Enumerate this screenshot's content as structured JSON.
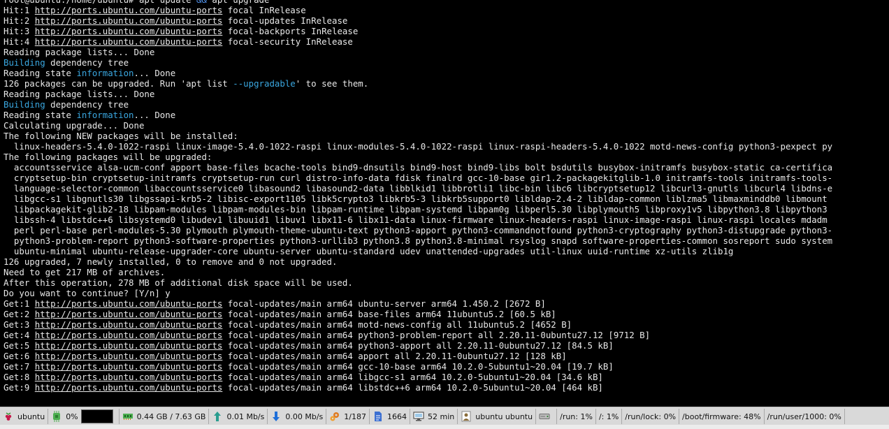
{
  "terminal": {
    "lines": [
      [
        {
          "t": "root@ubuntu:/home/ubuntu# apt update "
        },
        {
          "t": "&&",
          "c": "blue"
        },
        {
          "t": " apt upgrade"
        }
      ],
      [
        {
          "t": "Hit:1 "
        },
        {
          "t": "http://ports.ubuntu.com/ubuntu-ports",
          "c": "url"
        },
        {
          "t": " focal InRelease"
        }
      ],
      [
        {
          "t": "Hit:2 "
        },
        {
          "t": "http://ports.ubuntu.com/ubuntu-ports",
          "c": "url"
        },
        {
          "t": " focal-updates InRelease"
        }
      ],
      [
        {
          "t": "Hit:3 "
        },
        {
          "t": "http://ports.ubuntu.com/ubuntu-ports",
          "c": "url"
        },
        {
          "t": " focal-backports InRelease"
        }
      ],
      [
        {
          "t": "Hit:4 "
        },
        {
          "t": "http://ports.ubuntu.com/ubuntu-ports",
          "c": "url"
        },
        {
          "t": " focal-security InRelease"
        }
      ],
      [
        {
          "t": "Reading package lists... Done"
        }
      ],
      [
        {
          "t": "Building",
          "c": "cyan"
        },
        {
          "t": " dependency tree"
        }
      ],
      [
        {
          "t": "Reading state "
        },
        {
          "t": "information",
          "c": "cyan"
        },
        {
          "t": "... Done"
        }
      ],
      [
        {
          "t": "126 packages can be upgraded. Run 'apt list "
        },
        {
          "t": "--upgradable",
          "c": "cyan"
        },
        {
          "t": "' to see them."
        }
      ],
      [
        {
          "t": "Reading package lists... Done"
        }
      ],
      [
        {
          "t": "Building",
          "c": "cyan"
        },
        {
          "t": " dependency tree"
        }
      ],
      [
        {
          "t": "Reading state "
        },
        {
          "t": "information",
          "c": "cyan"
        },
        {
          "t": "... Done"
        }
      ],
      [
        {
          "t": "Calculating upgrade... Done"
        }
      ],
      [
        {
          "t": "The following NEW packages will be installed:"
        }
      ],
      [
        {
          "t": "  linux-headers-5.4.0-1022-raspi linux-image-5.4.0-1022-raspi linux-modules-5.4.0-1022-raspi linux-raspi-headers-5.4.0-1022 motd-news-config python3-pexpect py"
        }
      ],
      [
        {
          "t": "The following packages will be upgraded:"
        }
      ],
      [
        {
          "t": "  accountsservice alsa-ucm-conf apport base-files bcache-tools bind9-dnsutils bind9-host bind9-libs bolt bsdutils busybox-initramfs busybox-static ca-certifica"
        }
      ],
      [
        {
          "t": "  cryptsetup-bin cryptsetup-initramfs cryptsetup-run curl distro-info-data fdisk finalrd gcc-10-base gir1.2-packagekitglib-1.0 initramfs-tools initramfs-tools-"
        }
      ],
      [
        {
          "t": "  language-selector-common libaccountsservice0 libasound2 libasound2-data libblkid1 libbrotli1 libc-bin libc6 libcryptsetup12 libcurl3-gnutls libcurl4 libdns-e"
        }
      ],
      [
        {
          "t": "  libgcc-s1 libgnutls30 libgssapi-krb5-2 libisc-export1105 libk5crypto3 libkrb5-3 libkrb5support0 libldap-2.4-2 libldap-common liblzma5 libmaxminddb0 libmount"
        }
      ],
      [
        {
          "t": "  libpackagekit-glib2-18 libpam-modules libpam-modules-bin libpam-runtime libpam-systemd libpam0g libperl5.30 libplymouth5 libproxy1v5 libpython3.8 libpython3"
        }
      ],
      [
        {
          "t": "  libssh-4 libstdc++6 libsystemd0 libudev1 libuuid1 libuv1 libx11-6 libx11-data linux-firmware linux-headers-raspi linux-image-raspi linux-raspi locales mdadm"
        }
      ],
      [
        {
          "t": "  perl perl-base perl-modules-5.30 plymouth plymouth-theme-ubuntu-text python3-apport python3-commandnotfound python3-cryptography python3-distupgrade python3-"
        }
      ],
      [
        {
          "t": "  python3-problem-report python3-software-properties python3-urllib3 python3.8 python3.8-minimal rsyslog snapd software-properties-common sosreport sudo system"
        }
      ],
      [
        {
          "t": "  ubuntu-minimal ubuntu-release-upgrader-core ubuntu-server ubuntu-standard udev unattended-upgrades util-linux uuid-runtime xz-utils zlib1g"
        }
      ],
      [
        {
          "t": "126 upgraded, 7 newly installed, 0 to remove and 0 not upgraded."
        }
      ],
      [
        {
          "t": "Need to get 217 MB of archives."
        }
      ],
      [
        {
          "t": "After this operation, 278 MB of additional disk space will be used."
        }
      ],
      [
        {
          "t": "Do you want to continue? [Y/n] y"
        }
      ],
      [
        {
          "t": "Get:1 "
        },
        {
          "t": "http://ports.ubuntu.com/ubuntu-ports",
          "c": "url"
        },
        {
          "t": " focal-updates/main arm64 ubuntu-server arm64 1.450.2 [2672 B]"
        }
      ],
      [
        {
          "t": "Get:2 "
        },
        {
          "t": "http://ports.ubuntu.com/ubuntu-ports",
          "c": "url"
        },
        {
          "t": " focal-updates/main arm64 base-files arm64 11ubuntu5.2 [60.5 kB]"
        }
      ],
      [
        {
          "t": "Get:3 "
        },
        {
          "t": "http://ports.ubuntu.com/ubuntu-ports",
          "c": "url"
        },
        {
          "t": " focal-updates/main arm64 motd-news-config all 11ubuntu5.2 [4652 B]"
        }
      ],
      [
        {
          "t": "Get:4 "
        },
        {
          "t": "http://ports.ubuntu.com/ubuntu-ports",
          "c": "url"
        },
        {
          "t": " focal-updates/main arm64 python3-problem-report all 2.20.11-0ubuntu27.12 [9712 B]"
        }
      ],
      [
        {
          "t": "Get:5 "
        },
        {
          "t": "http://ports.ubuntu.com/ubuntu-ports",
          "c": "url"
        },
        {
          "t": " focal-updates/main arm64 python3-apport all 2.20.11-0ubuntu27.12 [84.5 kB]"
        }
      ],
      [
        {
          "t": "Get:6 "
        },
        {
          "t": "http://ports.ubuntu.com/ubuntu-ports",
          "c": "url"
        },
        {
          "t": " focal-updates/main arm64 apport all 2.20.11-0ubuntu27.12 [128 kB]"
        }
      ],
      [
        {
          "t": "Get:7 "
        },
        {
          "t": "http://ports.ubuntu.com/ubuntu-ports",
          "c": "url"
        },
        {
          "t": " focal-updates/main arm64 gcc-10-base arm64 10.2.0-5ubuntu1~20.04 [19.7 kB]"
        }
      ],
      [
        {
          "t": "Get:8 "
        },
        {
          "t": "http://ports.ubuntu.com/ubuntu-ports",
          "c": "url"
        },
        {
          "t": " focal-updates/main arm64 libgcc-s1 arm64 10.2.0-5ubuntu1~20.04 [34.6 kB]"
        }
      ],
      [
        {
          "t": "Get:9 "
        },
        {
          "t": "http://ports.ubuntu.com/ubuntu-ports",
          "c": "url"
        },
        {
          "t": " focal-updates/main arm64 libstdc++6 arm64 10.2.0-5ubuntu1~20.04 [464 kB]"
        }
      ]
    ]
  },
  "taskbar": {
    "items": [
      {
        "name": "menu-ubuntu",
        "icon": "raspberry-icon",
        "label": "ubuntu",
        "color": "#c51a4a"
      },
      {
        "name": "cpu-usage",
        "icon": "cpu-chip-icon",
        "label": "0%",
        "color": "#4caf50",
        "graph": true
      },
      {
        "name": "memory-usage",
        "icon": "memory-icon",
        "label": "0.44 GB / 7.63 GB",
        "color": "#4caf50"
      },
      {
        "name": "net-upload",
        "icon": "upload-arrow-icon",
        "label": "0.01 Mb/s",
        "color": "#2a9d8f"
      },
      {
        "name": "net-download",
        "icon": "download-arrow-icon",
        "label": "0.00 Mb/s",
        "color": "#1e6fd9"
      },
      {
        "name": "processes",
        "icon": "gears-icon",
        "label": "1/187",
        "color": "#e07a1f"
      },
      {
        "name": "threads",
        "icon": "document-icon",
        "label": "1664",
        "color": "#3b6fd1"
      },
      {
        "name": "uptime",
        "icon": "monitor-icon",
        "label": "52 min",
        "color": "#555555"
      },
      {
        "name": "user",
        "icon": "user-icon",
        "label": "ubuntu  ubuntu",
        "color": "#8a6d3b"
      },
      {
        "name": "disk-drive",
        "icon": "hard-drive-icon",
        "label": "",
        "color": "#666666"
      },
      {
        "name": "mount-run",
        "icon": "",
        "label": "/run: 1%",
        "color": ""
      },
      {
        "name": "mount-root",
        "icon": "",
        "label": "/: 1%",
        "color": ""
      },
      {
        "name": "mount-run-lock",
        "icon": "",
        "label": "/run/lock: 0%",
        "color": ""
      },
      {
        "name": "mount-boot-firmware",
        "icon": "",
        "label": "/boot/firmware: 48%",
        "color": ""
      },
      {
        "name": "mount-run-user",
        "icon": "",
        "label": "/run/user/1000: 0%",
        "color": ""
      }
    ]
  }
}
